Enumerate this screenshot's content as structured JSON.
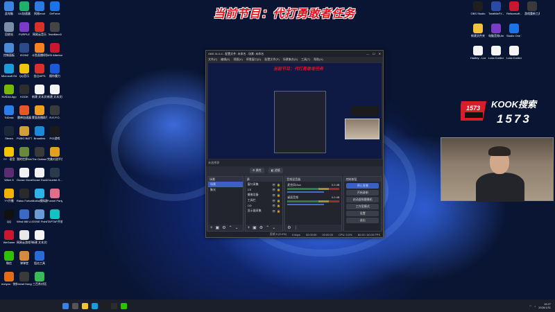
{
  "banner": {
    "text": "当前节目：代打勇敢者任务"
  },
  "desktop_icons_col1": [
    {
      "label": "此电脑",
      "color": "#3a83e0"
    },
    {
      "label": "回收站",
      "color": "#7a8ea8"
    },
    {
      "label": "控制面板",
      "color": "#4a8ad8"
    },
    {
      "label": "Microsoft Edge",
      "color": "#1a9cd8"
    },
    {
      "label": "NVIDIA App",
      "color": "#76b900"
    },
    {
      "label": "ToDesk",
      "color": "#2b7de9"
    },
    {
      "label": "Steam",
      "color": "#1b2838"
    },
    {
      "label": "YY · 语音",
      "color": "#f5c400"
    },
    {
      "label": "Witch It",
      "color": "#5b2c6f"
    },
    {
      "label": "YY开播",
      "color": "#f0b400"
    },
    {
      "label": "QQ",
      "color": "#111"
    },
    {
      "label": "WeGame",
      "color": "#c8172f"
    },
    {
      "label": "微信",
      "color": "#2dc100"
    },
    {
      "label": "eunyou · 快捷方式",
      "color": "#e06d1b"
    }
  ],
  "desktop_icons_col2": [
    {
      "label": "UU加速器",
      "color": "#1fb06b"
    },
    {
      "label": "PURPLE",
      "color": "#7a3cc8"
    },
    {
      "label": "iGONZ",
      "color": "#2a4a8a"
    },
    {
      "label": "QQ音乐",
      "color": "#f1c40f"
    },
    {
      "label": "KOOK",
      "color": "#2d2d2d"
    },
    {
      "label": "雷神加速器",
      "color": "#e8572a"
    },
    {
      "label": "PUBG BATTLEGR...",
      "color": "#d1a03a"
    },
    {
      "label": "我的世界WeGame",
      "color": "#6a8a3a"
    },
    {
      "label": "Goose Goose Duck",
      "color": "#f1f1f1"
    },
    {
      "label": "Raiso Fortune",
      "color": "#2a2a2a"
    },
    {
      "label": "Wind Mill U-BANK",
      "color": "#3a6ac8"
    },
    {
      "label": "网易云游戏平台",
      "color": "#e8e8e8"
    },
    {
      "label": "弹弹堂",
      "color": "#d88a3a"
    },
    {
      "label": "Dread Hunger",
      "color": "#3a3a3a"
    }
  ],
  "desktop_icons_col3": [
    {
      "label": "网易mod",
      "color": "#2c7be5"
    },
    {
      "label": "网易云音乐",
      "color": "#d9312a"
    },
    {
      "label": "斗鱼直播伴侣",
      "color": "#f58220"
    },
    {
      "label": "金山WPS",
      "color": "#d9312a"
    },
    {
      "label": "新建 文本文档",
      "color": "#f5f5f5"
    },
    {
      "label": "蒙面直播助手",
      "color": "#f0a020"
    },
    {
      "label": "Broadlink",
      "color": "#1a8ad8"
    },
    {
      "label": "The Outlast Trials",
      "color": "#3a3a3a"
    },
    {
      "label": "Goose Duck 模拟器",
      "color": "#f1f1f1"
    },
    {
      "label": "MuMu模拟器",
      "color": "#2db3e8"
    },
    {
      "label": "GONE Fishing",
      "color": "#6a9ad8"
    },
    {
      "label": "新建 文本文档 (2)",
      "color": "#f5f5f5"
    },
    {
      "label": "狙击工具",
      "color": "#2a6ad8"
    },
    {
      "label": "三百杀对话",
      "color": "#3ab85a"
    }
  ],
  "desktop_icons_col4": [
    {
      "label": "GeForce",
      "color": "#1a73e8"
    },
    {
      "label": "TeshMem3",
      "color": "#444"
    },
    {
      "label": "MSI Afterburner",
      "color": "#c8172f"
    },
    {
      "label": "随你魔力",
      "color": "#1a5ad8"
    },
    {
      "label": "新建 文本文档",
      "color": "#f5f5f5"
    },
    {
      "label": "R.E.P.O.",
      "color": "#3a3a3a"
    },
    {
      "label": "PGI游戏",
      "color": "#1a1a1a"
    },
    {
      "label": "完美对战平台 WeGame",
      "color": "#e0a020"
    },
    {
      "label": "Counter-S...",
      "color": "#2a3a4a"
    },
    {
      "label": "Funnel Party",
      "color": "#e06d8a"
    },
    {
      "label": "TAPTAP开放平台",
      "color": "#13c2c2"
    }
  ],
  "desktop_icons_right_top": [
    {
      "label": "OBS Studio",
      "color": "#1f1f1f"
    },
    {
      "label": "TotalMixFX - 快捷方式",
      "color": "#2a4aa8"
    },
    {
      "label": "Refacesoft - 快捷方式",
      "color": "#c8172f"
    },
    {
      "label": "游戏重新工具箱 - 快捷方式",
      "color": "#3a3a3a"
    },
    {
      "label": "新建文件夹",
      "color": "#f1c23a"
    },
    {
      "label": "电脑音效Lite",
      "color": "#7a3cc8"
    },
    {
      "label": "Studio One 7",
      "color": "#1a73e8"
    },
    {
      "label": "Hadley - Loser Control...",
      "color": "#f5f5f5"
    },
    {
      "label": "Loss Control 快捷...",
      "color": "#f5f5f5"
    },
    {
      "label": "Loss Control-8...",
      "color": "#f5f5f5"
    }
  ],
  "obs": {
    "title": "OBS 31.0.4 - 配置文件: 未命名 - 场景: 未命名",
    "menu": [
      "文件(F)",
      "编辑(E)",
      "视图(V)",
      "停靠窗口(D)",
      "配置文件(P)",
      "场景集合(S)",
      "工具(T)",
      "帮助(H)"
    ],
    "inner_banner": "当前节目：代打勇敢者任务",
    "source_name": "未选择源",
    "toolbar_props": "⚙ 属性",
    "toolbar_filters": "◧ 滤镜",
    "scenes_header": "场景",
    "scenes": [
      "场景",
      "聚光"
    ],
    "sources_header": "源",
    "sources": [
      "窗口采集",
      "CS",
      "摄像设备",
      "工具栏",
      "OD",
      "显示器采集"
    ],
    "mixer_header": "音频混音器",
    "mixer": [
      {
        "name": "麦克风/Aux",
        "db": "0.0 dB"
      },
      {
        "name": "桌面音频",
        "db": "0.0 dB"
      }
    ],
    "controls_header": "控制按钮",
    "controls": [
      "停止直播",
      "开始录制",
      "启动虚拟摄像机",
      "工作室模式",
      "设置",
      "退出"
    ],
    "status": {
      "frames": "丢帧 0 (0.0%)",
      "kbps": "0 kbps",
      "live_time": "00:00:00",
      "rec_time": "00:00:00",
      "cpu": "CPU: 0.0%",
      "fps": "60.00 / 60.00 FPS"
    }
  },
  "kook": {
    "title": "KOOK搜索",
    "number": "1573",
    "logo_text": "1573"
  },
  "taskbar": {
    "weather": "",
    "time": "15:27",
    "date": "2026/1/31"
  }
}
